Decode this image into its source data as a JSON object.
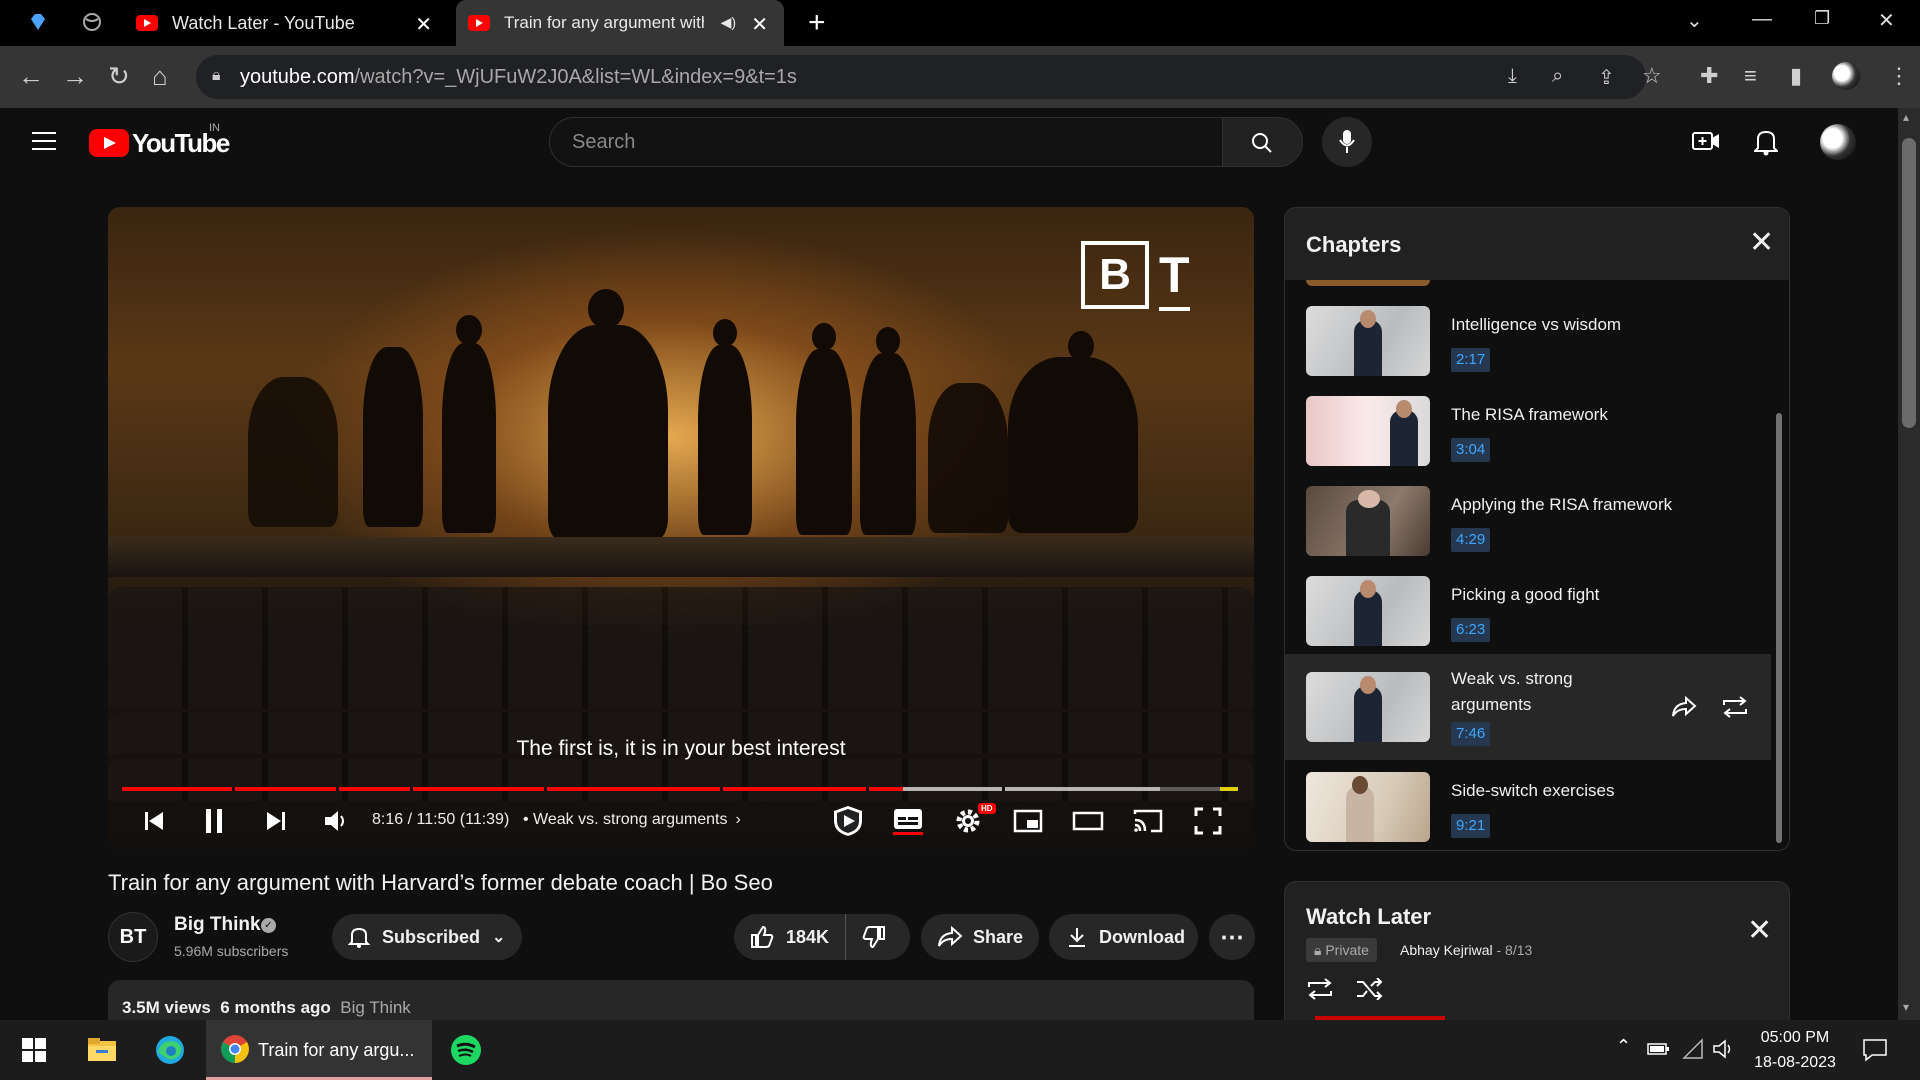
{
  "browser": {
    "tabs": [
      {
        "title": "Watch Later - YouTube"
      },
      {
        "title": "Train for any argument with Harvard's"
      }
    ],
    "url": {
      "domain": "youtube.com",
      "path": "/watch?v=_WjUFuW2J0A&list=WL&index=9&t=1s"
    }
  },
  "youtube": {
    "logo_text": "YouTube",
    "country": "IN",
    "search_placeholder": "Search"
  },
  "player": {
    "caption": "The first is, it is in your best interest",
    "time": "8:16 / 11:50 (11:39)",
    "chapter": "• Weak vs. strong arguments",
    "played_fraction": 0.7,
    "loaded_fraction": 0.93,
    "hd_badge": "HD",
    "brand": {
      "b": "B",
      "t": "T"
    }
  },
  "video": {
    "title": "Train for any argument with Harvard’s former debate coach | Bo Seo",
    "channel": {
      "name": "Big Think",
      "subscribers": "5.96M subscribers",
      "avatar": "BT"
    },
    "subscribe_label": "Subscribed",
    "likes": "184K",
    "share_label": "Share",
    "download_label": "Download",
    "views": "3.5M views",
    "age": "6 months ago",
    "hashtag_channel": "Big Think"
  },
  "chapters": {
    "title": "Chapters",
    "items": [
      {
        "name": "Intelligence vs wisdom",
        "time": "2:17"
      },
      {
        "name": "The RISA framework",
        "time": "3:04"
      },
      {
        "name": "Applying the RISA framework",
        "time": "4:29"
      },
      {
        "name": "Picking a good fight",
        "time": "6:23"
      },
      {
        "name": "Weak vs. strong arguments",
        "time": "7:46",
        "active": true
      },
      {
        "name": "Side-switch exercises",
        "time": "9:21"
      }
    ]
  },
  "watch_later": {
    "title": "Watch Later",
    "privacy": "Private",
    "owner": "Abhay Kejriwal",
    "position": "- 8/13"
  },
  "taskbar": {
    "chrome_label": "Train for any argu...",
    "time": "05:00 PM",
    "date": "18-08-2023"
  },
  "colors": {
    "accent": "#ff0000",
    "link": "#3ea6ff",
    "background": "#0f0f0f"
  }
}
